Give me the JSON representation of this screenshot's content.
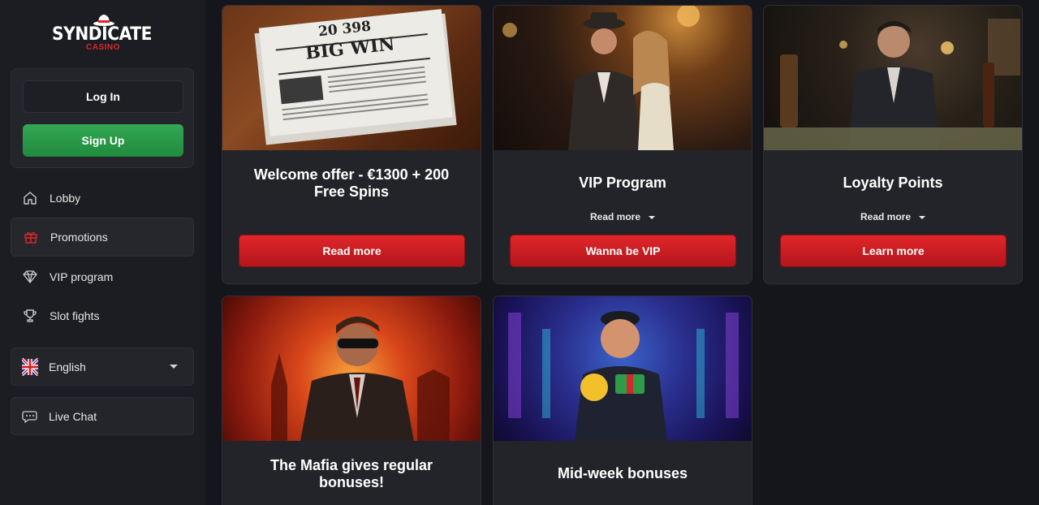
{
  "brand": {
    "name": "SYNDICATE",
    "sub": "CASINO",
    "accent": "#e0262a"
  },
  "auth": {
    "login_label": "Log In",
    "signup_label": "Sign Up"
  },
  "nav": {
    "items": [
      {
        "label": "Lobby",
        "icon": "home-icon"
      },
      {
        "label": "Promotions",
        "icon": "gift-icon",
        "active": true
      },
      {
        "label": "VIP program",
        "icon": "diamond-icon"
      },
      {
        "label": "Slot fights",
        "icon": "trophy-icon"
      }
    ]
  },
  "language": {
    "selected": "English",
    "icon": "uk-flag-icon"
  },
  "chat": {
    "label": "Live Chat",
    "icon": "chat-icon"
  },
  "promos": [
    {
      "title": "Welcome offer - €1300 + 200 Free Spins",
      "button": "Read more",
      "image_text_top": "20 398",
      "image_text_main": "BIG WIN"
    },
    {
      "title": "VIP Program",
      "link": "Read more",
      "button": "Wanna be VIP"
    },
    {
      "title": "Loyalty Points",
      "link": "Read more",
      "button": "Learn more"
    },
    {
      "title": "The Mafia gives regular bonuses!"
    },
    {
      "title": "Mid-week bonuses"
    }
  ]
}
